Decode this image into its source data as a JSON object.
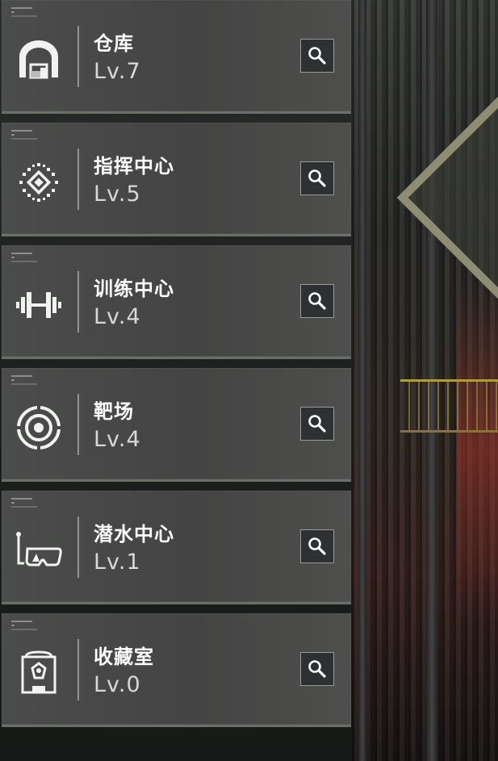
{
  "facilities": [
    {
      "name": "仓库",
      "level": "Lv.7",
      "icon": "warehouse-icon"
    },
    {
      "name": "指挥中心",
      "level": "Lv.5",
      "icon": "command-center-icon"
    },
    {
      "name": "训练中心",
      "level": "Lv.4",
      "icon": "dumbbell-icon"
    },
    {
      "name": "靶场",
      "level": "Lv.4",
      "icon": "target-icon"
    },
    {
      "name": "潜水中心",
      "level": "Lv.1",
      "icon": "diving-mask-icon"
    },
    {
      "name": "收藏室",
      "level": "Lv.0",
      "icon": "display-case-icon"
    }
  ],
  "colors": {
    "card_bg": "#484948",
    "text_primary": "#ffffff",
    "text_secondary": "#d8d8d8",
    "button_bg": "#2f3031"
  }
}
